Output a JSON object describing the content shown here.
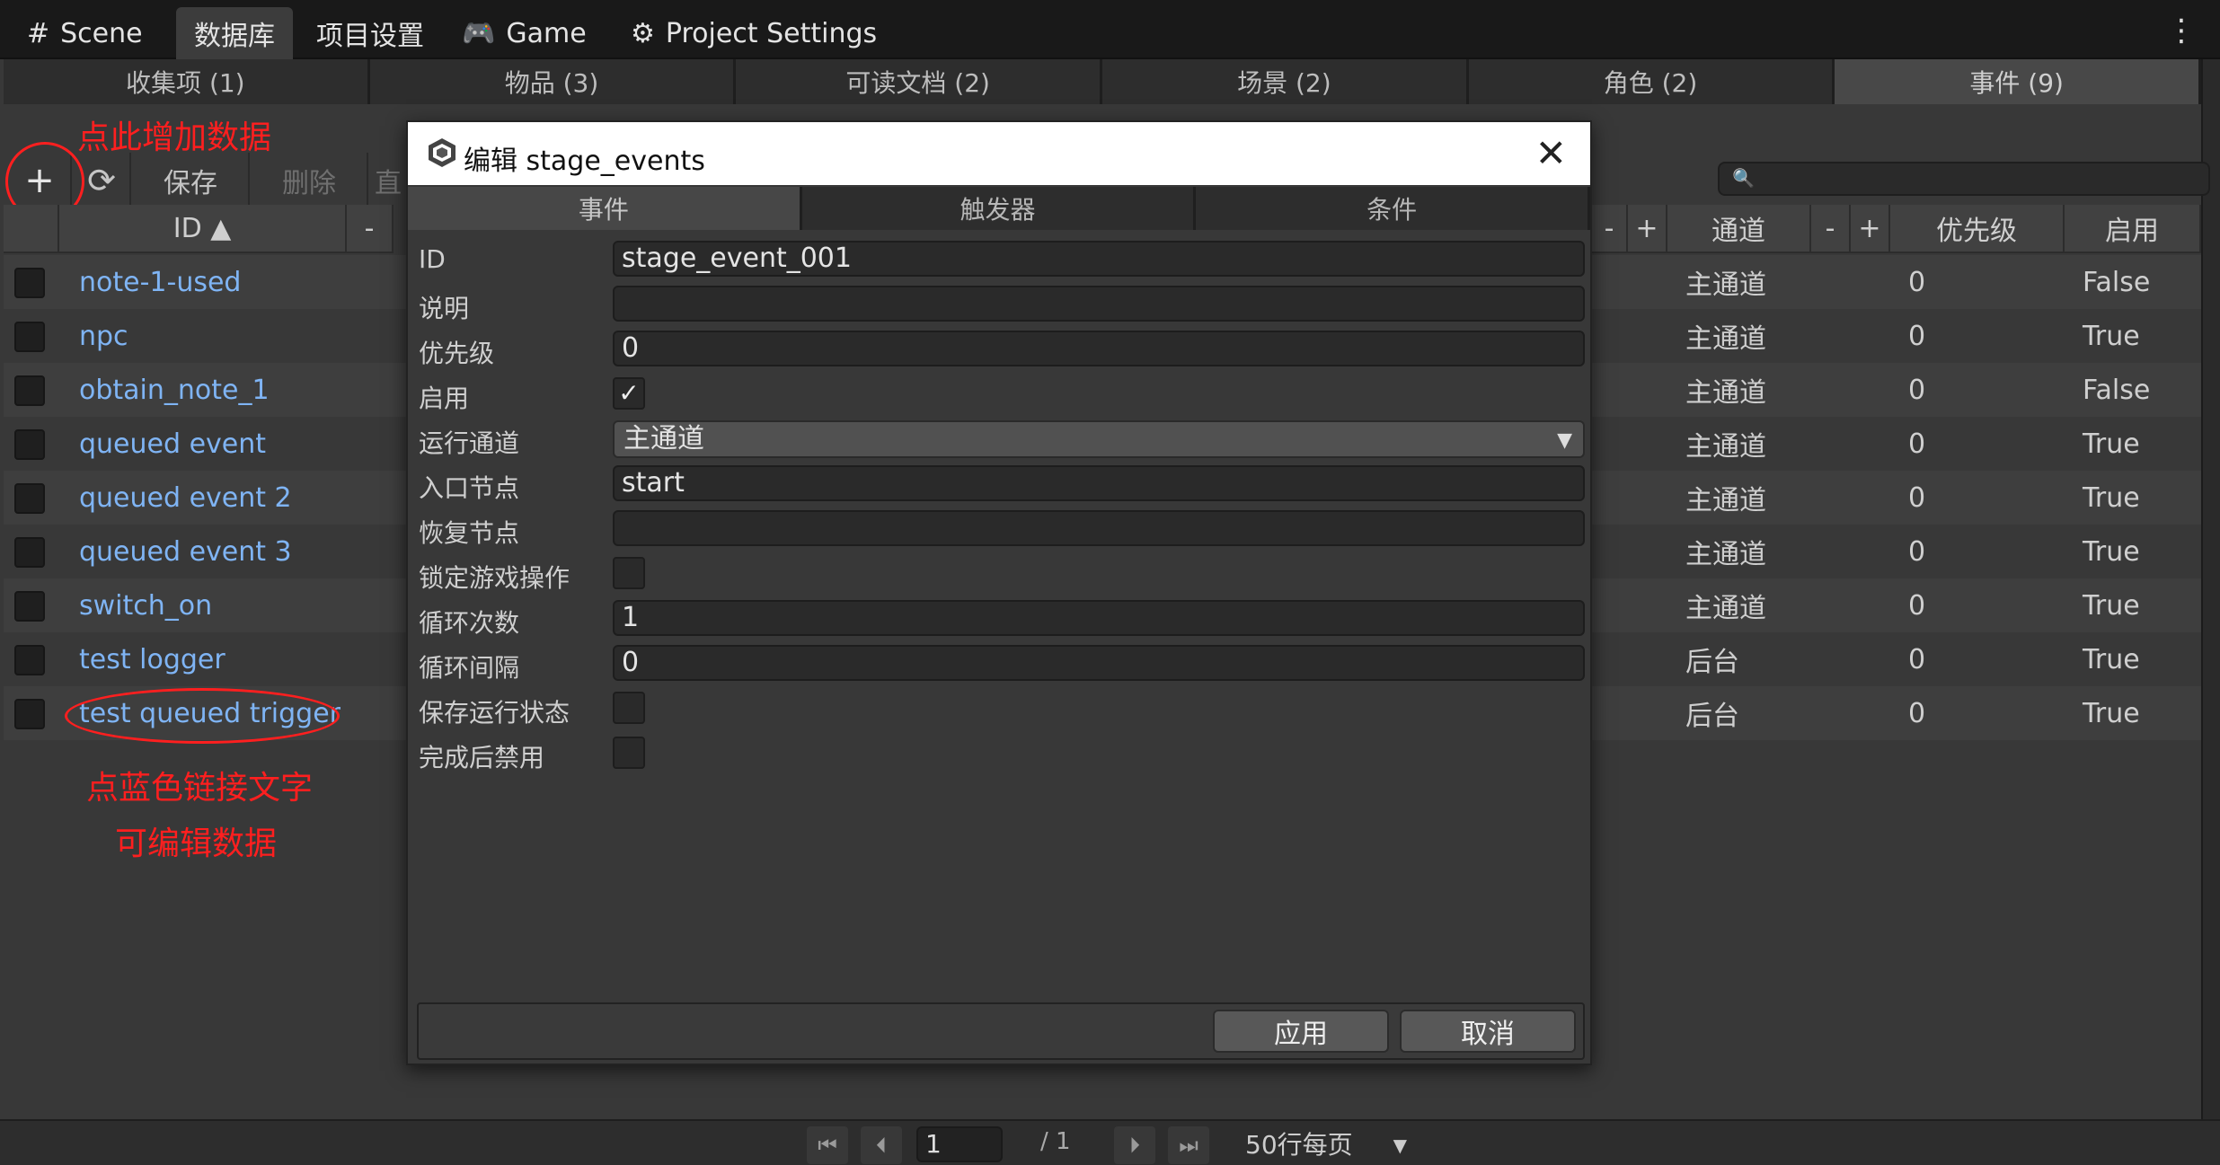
{
  "top_tabs": [
    {
      "label": "Scene",
      "icon": "#"
    },
    {
      "label": "数据库",
      "icon": ""
    },
    {
      "label": "项目设置",
      "icon": ""
    },
    {
      "label": "Game",
      "icon": "🎮"
    },
    {
      "label": "Project Settings",
      "icon": "⚙"
    }
  ],
  "category_tabs": [
    "收集项 (1)",
    "物品 (3)",
    "可读文档 (2)",
    "场景 (2)",
    "角色 (2)",
    "事件 (9)"
  ],
  "annotations": {
    "add_hint": "点此增加数据",
    "link_hint_1": "点蓝色链接文字",
    "link_hint_2": "可编辑数据"
  },
  "toolbar": {
    "add": "+",
    "refresh": "⟳",
    "save": "保存",
    "delete": "删除",
    "more": "直"
  },
  "columns": {
    "id": "ID ▲",
    "minus": "-",
    "plus": "+",
    "channel": "通道",
    "priority": "优先级",
    "enabled": "启用"
  },
  "rows": [
    {
      "id": "note-1-used",
      "channel": "主通道",
      "priority": "0",
      "enabled": "False"
    },
    {
      "id": "npc",
      "channel": "主通道",
      "priority": "0",
      "enabled": "True"
    },
    {
      "id": "obtain_note_1",
      "channel": "主通道",
      "priority": "0",
      "enabled": "False"
    },
    {
      "id": "queued event",
      "channel": "主通道",
      "priority": "0",
      "enabled": "True"
    },
    {
      "id": "queued event 2",
      "channel": "主通道",
      "priority": "0",
      "enabled": "True"
    },
    {
      "id": "queued event 3",
      "channel": "主通道",
      "priority": "0",
      "enabled": "True"
    },
    {
      "id": "switch_on",
      "channel": "主通道",
      "priority": "0",
      "enabled": "True"
    },
    {
      "id": "test logger",
      "channel": "后台",
      "priority": "0",
      "enabled": "True"
    },
    {
      "id": "test queued trigger",
      "channel": "后台",
      "priority": "0",
      "enabled": "True"
    }
  ],
  "dialog": {
    "title": "编辑 stage_events",
    "close": "✕",
    "tabs": [
      "事件",
      "触发器",
      "条件"
    ],
    "fields": {
      "id_label": "ID",
      "id_value": "stage_event_001",
      "desc_label": "说明",
      "desc_value": "",
      "priority_label": "优先级",
      "priority_value": "0",
      "enabled_label": "启用",
      "enabled_check": "✓",
      "channel_label": "运行通道",
      "channel_value": "主通道",
      "entry_label": "入口节点",
      "entry_value": "start",
      "resume_label": "恢复节点",
      "resume_value": "",
      "lock_label": "锁定游戏操作",
      "loop_count_label": "循环次数",
      "loop_count_value": "1",
      "loop_interval_label": "循环间隔",
      "loop_interval_value": "0",
      "save_state_label": "保存运行状态",
      "disable_after_label": "完成后禁用"
    },
    "apply": "应用",
    "cancel": "取消"
  },
  "pager": {
    "current_page": "1",
    "total": "/ 1",
    "per_page": "50行每页"
  }
}
